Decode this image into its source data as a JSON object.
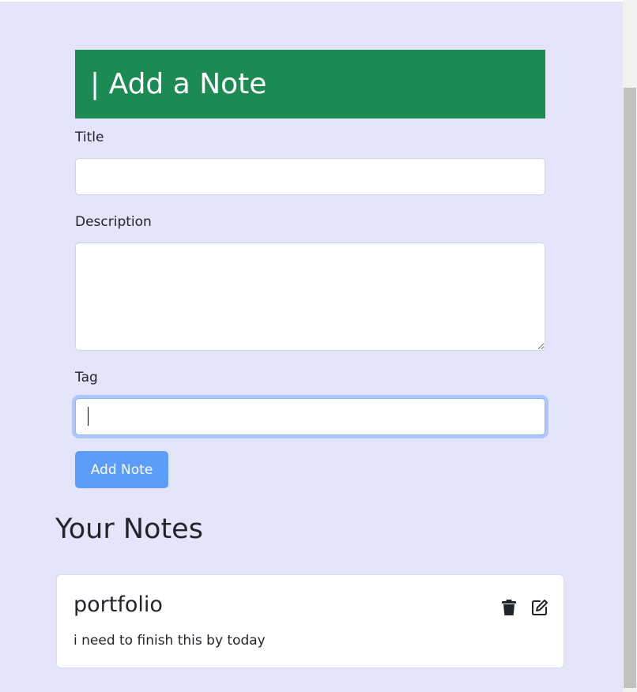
{
  "form": {
    "heading": "| Add a Note",
    "title_label": "Title",
    "title_value": "",
    "description_label": "Description",
    "description_value": "",
    "tag_label": "Tag",
    "tag_value": "",
    "submit_label": "Add Note"
  },
  "notes_section": {
    "heading": "Your Notes",
    "notes": [
      {
        "title": "portfolio",
        "description": "i need to finish this by today",
        "actions": [
          "trash-icon",
          "edit-icon"
        ]
      }
    ]
  },
  "colors": {
    "page_background": "#e4e4fa",
    "banner": "#1b8a53",
    "primary_button": "#5c9dfb",
    "focus_ring": "#86b7fe"
  }
}
